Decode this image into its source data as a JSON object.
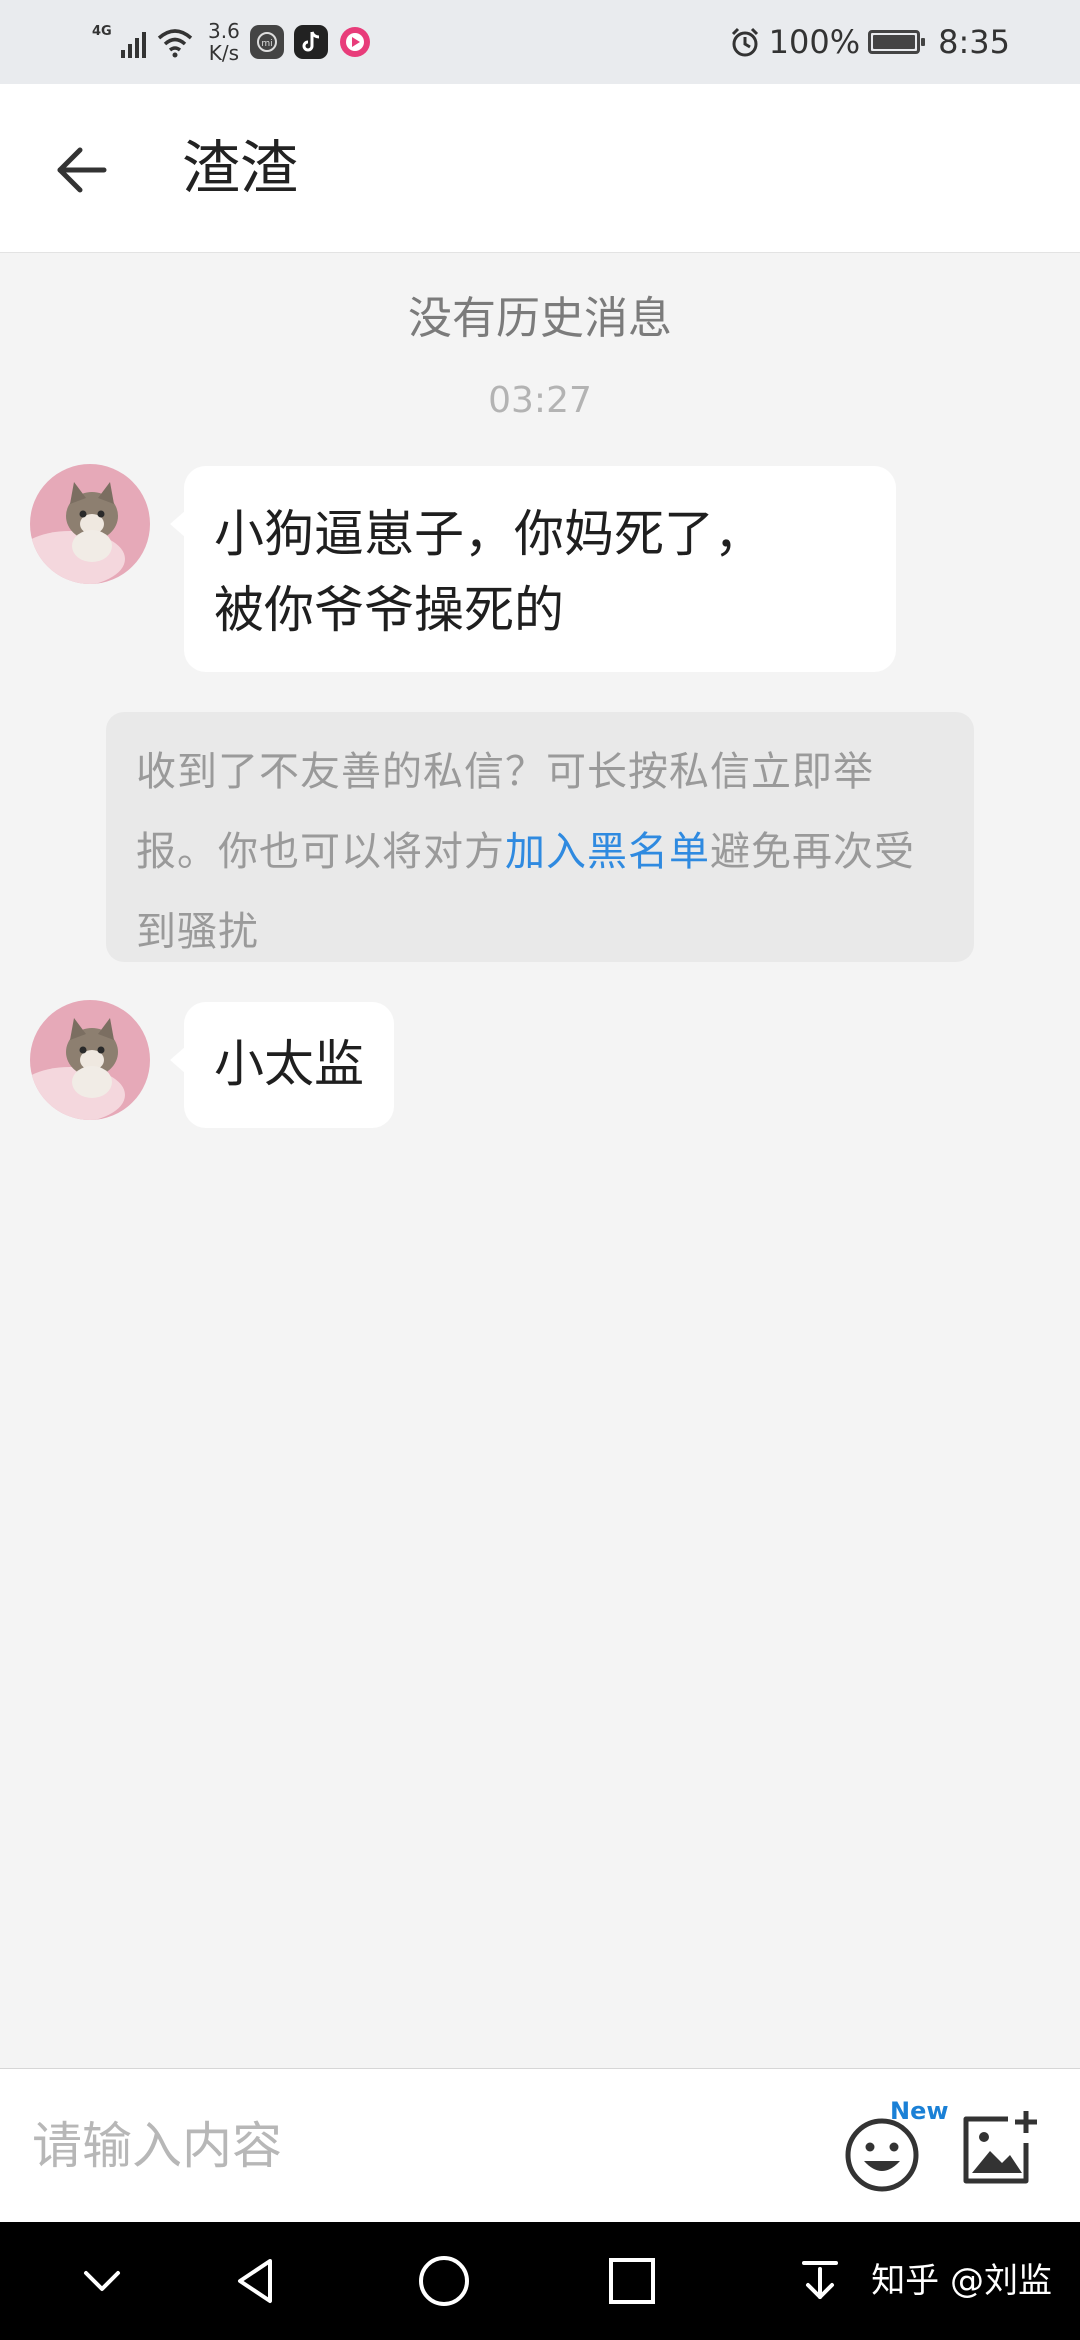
{
  "status_bar": {
    "network_type": "4G",
    "speed_value": "3.6",
    "speed_unit": "K/s",
    "battery": "100%",
    "time": "8:35"
  },
  "header": {
    "title": "渣渣",
    "back_icon": "arrow-left-icon"
  },
  "chat": {
    "no_history": "没有历史消息",
    "timestamp": "03:27",
    "messages": [
      {
        "line1": "小狗逼崽子，你妈死了，",
        "line2": "被你爷爷操死的"
      },
      {
        "text": "小太监"
      }
    ],
    "notice": {
      "before": "收到了不友善的私信？可长按私信立即举报。你也可以将对方",
      "link": "加入黑名单",
      "after": "避免再次受到骚扰"
    }
  },
  "input_bar": {
    "placeholder": "请输入内容",
    "emoji_badge": "New"
  },
  "watermark": "知乎 @刘监",
  "colors": {
    "link": "#2f8ae0",
    "background": "#f4f4f4",
    "badge": "#1a80d6"
  }
}
